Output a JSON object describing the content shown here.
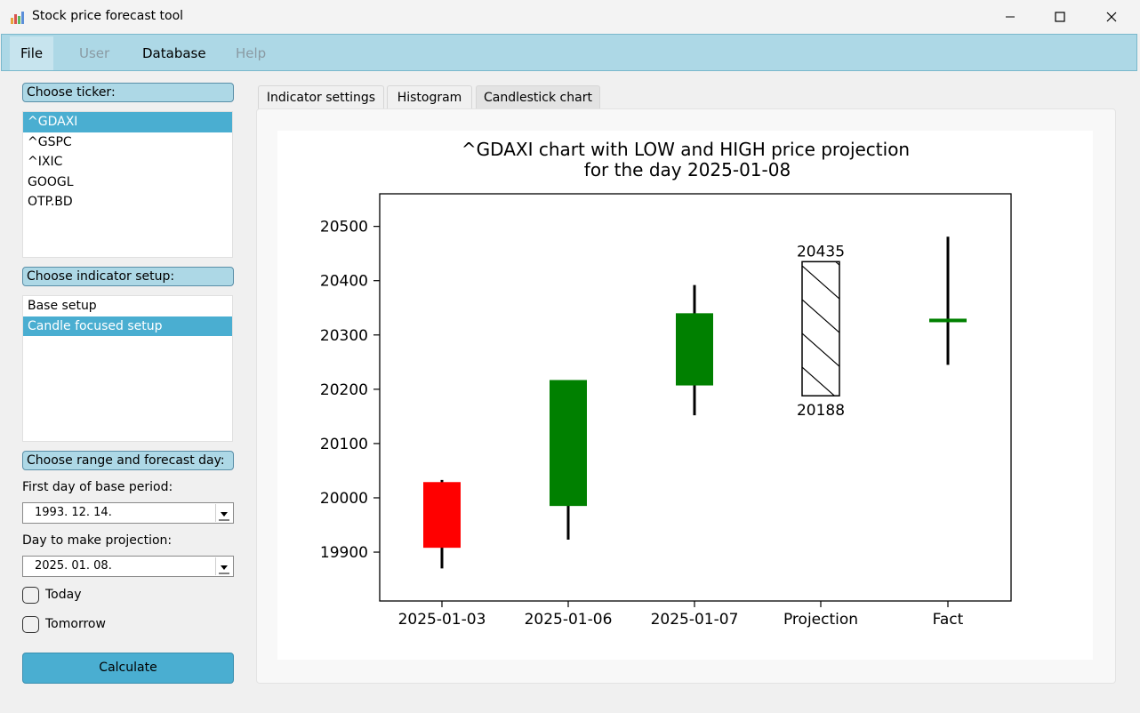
{
  "window": {
    "title": "Stock price forecast tool"
  },
  "menu": [
    {
      "label": "File",
      "state": "active"
    },
    {
      "label": "User",
      "state": "disabled"
    },
    {
      "label": "Database",
      "state": "enabled"
    },
    {
      "label": "Help",
      "state": "disabled"
    }
  ],
  "sidebar": {
    "ticker_label": "Choose ticker:",
    "tickers": [
      "^GDAXI",
      "^GSPC",
      "^IXIC",
      "GOOGL",
      "OTP.BD"
    ],
    "selected_ticker": "^GDAXI",
    "indicator_label": "Choose indicator setup:",
    "setups": [
      "Base setup",
      "Candle focused setup"
    ],
    "selected_setup": "Candle focused setup",
    "range_label": "Choose range and forecast day:",
    "first_day_label": "First day of base period:",
    "first_day_value": "1993. 12. 14.",
    "projection_day_label": "Day to make projection:",
    "projection_day_value": "2025. 01. 08.",
    "today_label": "Today",
    "today_checked": false,
    "tomorrow_label": "Tomorrow",
    "tomorrow_checked": false,
    "calculate_label": "Calculate"
  },
  "tabs": [
    {
      "label": "Indicator settings"
    },
    {
      "label": "Histogram"
    },
    {
      "label": "Candlestick chart"
    }
  ],
  "active_tab": "Candlestick chart",
  "colors": {
    "accent": "#4aaed1",
    "menu_bg": "#add8e6",
    "up": "#008000",
    "down": "#ff0000"
  },
  "chart_data": {
    "type": "candlestick",
    "title_line1": "^GDAXI chart with LOW and HIGH price projection",
    "title_line2": "for the day 2025-01-08",
    "categories": [
      "2025-01-03",
      "2025-01-06",
      "2025-01-07",
      "Projection",
      "Fact"
    ],
    "candles": [
      {
        "x": "2025-01-03",
        "open": 20029,
        "close": 19908,
        "high": 20033,
        "low": 19870,
        "color": "red"
      },
      {
        "x": "2025-01-06",
        "open": 19985,
        "close": 20217,
        "high": 20217,
        "low": 19923,
        "color": "green"
      },
      {
        "x": "2025-01-07",
        "open": 20207,
        "close": 20340,
        "high": 20392,
        "low": 20152,
        "color": "green"
      }
    ],
    "projection": {
      "low": 20188,
      "high": 20435,
      "low_label": "20188",
      "high_label": "20435"
    },
    "fact": {
      "open": 20326,
      "close": 20330,
      "high": 20481,
      "low": 20245,
      "color": "green"
    },
    "yticks": [
      19900,
      20000,
      20100,
      20200,
      20300,
      20400,
      20500
    ],
    "ylim": [
      19810,
      20560
    ]
  }
}
